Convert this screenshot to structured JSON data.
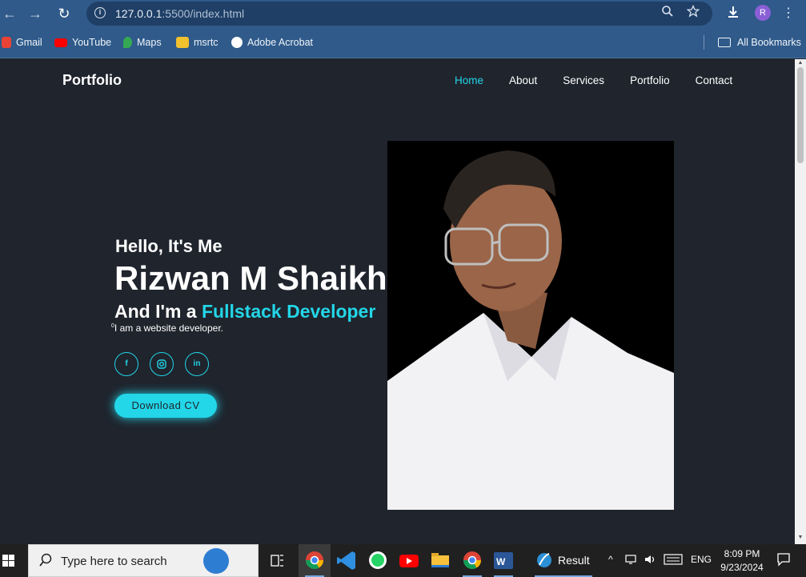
{
  "browser": {
    "url_host": "127.0.0.1",
    "url_rest": ":5500/index.html",
    "profile_initial": "R",
    "bookmarks": [
      {
        "label": "Gmail",
        "icon": "gmail-icon",
        "color": "#ea4335"
      },
      {
        "label": "YouTube",
        "icon": "youtube-icon",
        "color": "#ff0000"
      },
      {
        "label": "Maps",
        "icon": "maps-icon",
        "color": "#34a853"
      },
      {
        "label": "msrtc",
        "icon": "msrtc-icon",
        "color": "#f2c12e"
      },
      {
        "label": "Adobe Acrobat",
        "icon": "globe-icon",
        "color": "#ffffff"
      }
    ],
    "all_bookmarks": "All Bookmarks"
  },
  "site": {
    "logo": "Portfolio",
    "nav": [
      "Home",
      "About",
      "Services",
      "Portfolio",
      "Contact"
    ],
    "active_nav": "Home",
    "hero": {
      "hello": "Hello, It's Me",
      "name": "Rizwan M Shaikh",
      "role_prefix": "And I'm a ",
      "role_highlight": "Fullstack Developer",
      "desc_sup": "0",
      "desc": "I am a website developer.",
      "socials": [
        "facebook-icon",
        "instagram-icon",
        "linkedin-icon"
      ],
      "cv_button": "Download CV"
    },
    "accent_color": "#23d6e8",
    "bg_color": "#1f242d"
  },
  "taskbar": {
    "search_placeholder": "Type here to search",
    "apps": [
      "task-view-icon",
      "chrome-icon",
      "vscode-icon",
      "whatsapp-icon",
      "youtube-icon",
      "file-explorer-icon",
      "chrome-icon",
      "word-icon",
      "cricket-icon"
    ],
    "result_label": "Result",
    "language": "ENG",
    "time": "8:09 PM",
    "date": "9/23/2024"
  }
}
